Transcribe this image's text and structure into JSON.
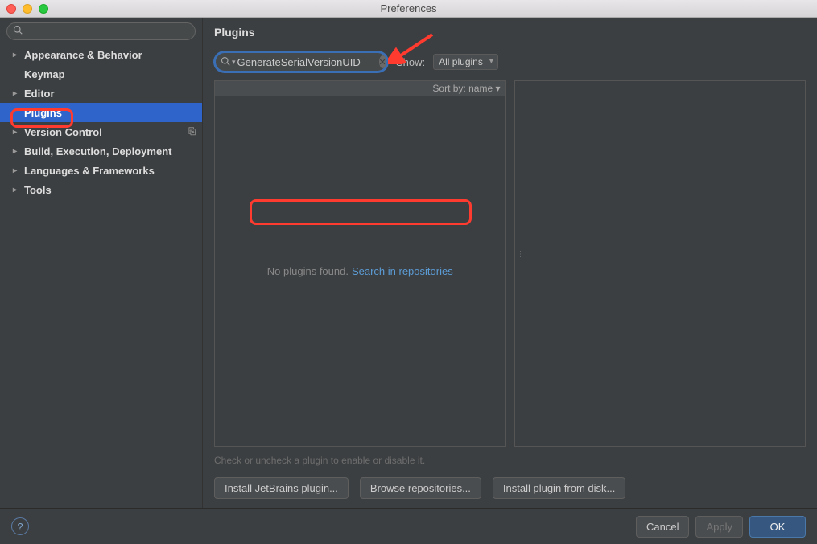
{
  "window": {
    "title": "Preferences"
  },
  "sidebar": {
    "search_placeholder": "",
    "items": [
      {
        "label": "Appearance & Behavior",
        "expandable": true
      },
      {
        "label": "Keymap",
        "expandable": false
      },
      {
        "label": "Editor",
        "expandable": true
      },
      {
        "label": "Plugins",
        "expandable": false,
        "selected": true
      },
      {
        "label": "Version Control",
        "expandable": true,
        "badge": true
      },
      {
        "label": "Build, Execution, Deployment",
        "expandable": true
      },
      {
        "label": "Languages & Frameworks",
        "expandable": true
      },
      {
        "label": "Tools",
        "expandable": true
      }
    ]
  },
  "main": {
    "heading": "Plugins",
    "search_value": "GenerateSerialVersionUID",
    "show_label": "Show:",
    "show_value": "All plugins",
    "sort_label": "Sort by: name",
    "empty_text": "No plugins found.",
    "empty_link": "Search in repositories",
    "hint": "Check or uncheck a plugin to enable or disable it.",
    "buttons": {
      "install_jb": "Install JetBrains plugin...",
      "browse": "Browse repositories...",
      "install_disk": "Install plugin from disk..."
    }
  },
  "footer": {
    "cancel": "Cancel",
    "apply": "Apply",
    "ok": "OK"
  }
}
